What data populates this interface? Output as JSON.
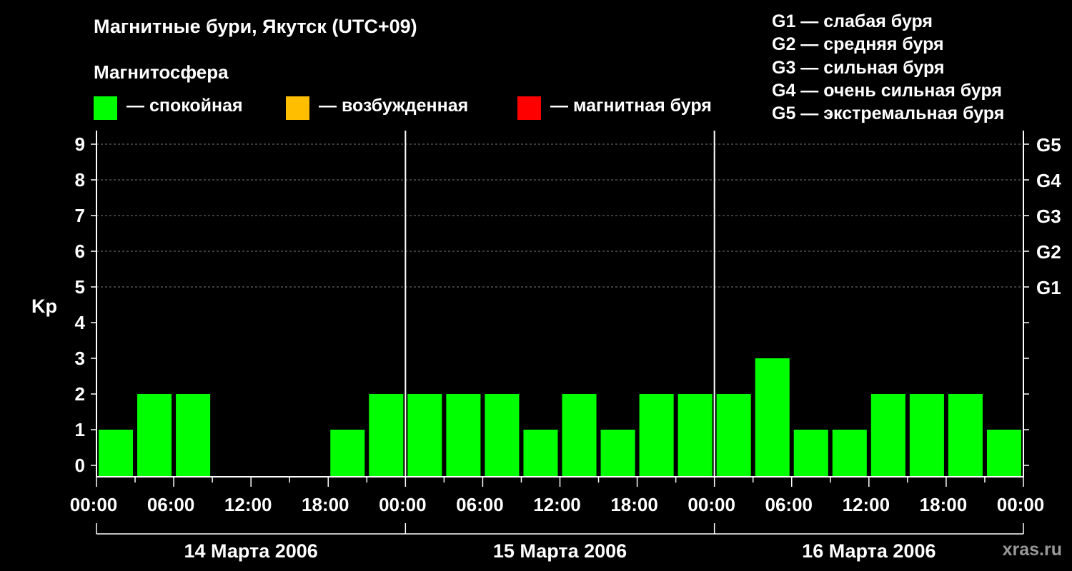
{
  "header": {
    "title": "Магнитные бури, Якутск (UTC+09)",
    "subtitle": "Магнитосфера"
  },
  "legend": [
    {
      "label": "— спокойная",
      "color": "#00ff00"
    },
    {
      "label": "— возбужденная",
      "color": "#ffbf00"
    },
    {
      "label": "— магнитная буря",
      "color": "#ff0000"
    }
  ],
  "g_scale": [
    "G1 — слабая буря",
    "G2 — средняя буря",
    "G3 — сильная буря",
    "G4 — очень сильная буря",
    "G5 — экстремальная буря"
  ],
  "watermark": "xras.ru",
  "chart_data": {
    "type": "bar",
    "ylabel": "Kp",
    "ylim": [
      0,
      9
    ],
    "yticks": [
      "0",
      "1",
      "2",
      "3",
      "4",
      "5",
      "6",
      "7",
      "8",
      "9"
    ],
    "right_axis_labels": [
      {
        "kp": 5,
        "label": "G1"
      },
      {
        "kp": 6,
        "label": "G2"
      },
      {
        "kp": 7,
        "label": "G3"
      },
      {
        "kp": 8,
        "label": "G4"
      },
      {
        "kp": 9,
        "label": "G5"
      }
    ],
    "x_tick_labels": [
      "00:00",
      "06:00",
      "12:00",
      "18:00",
      "00:00",
      "06:00",
      "12:00",
      "18:00",
      "00:00",
      "06:00",
      "12:00",
      "18:00",
      "00:00"
    ],
    "days": [
      "14 Марта 2006",
      "15 Марта 2006",
      "16 Марта 2006"
    ],
    "interval_hours": 3,
    "values": [
      1,
      2,
      2,
      0,
      0,
      0,
      1,
      2,
      2,
      2,
      2,
      1,
      2,
      1,
      2,
      2,
      2,
      3,
      1,
      1,
      2,
      2,
      2,
      1
    ],
    "bar_color": "#00ff00",
    "grid": true
  }
}
